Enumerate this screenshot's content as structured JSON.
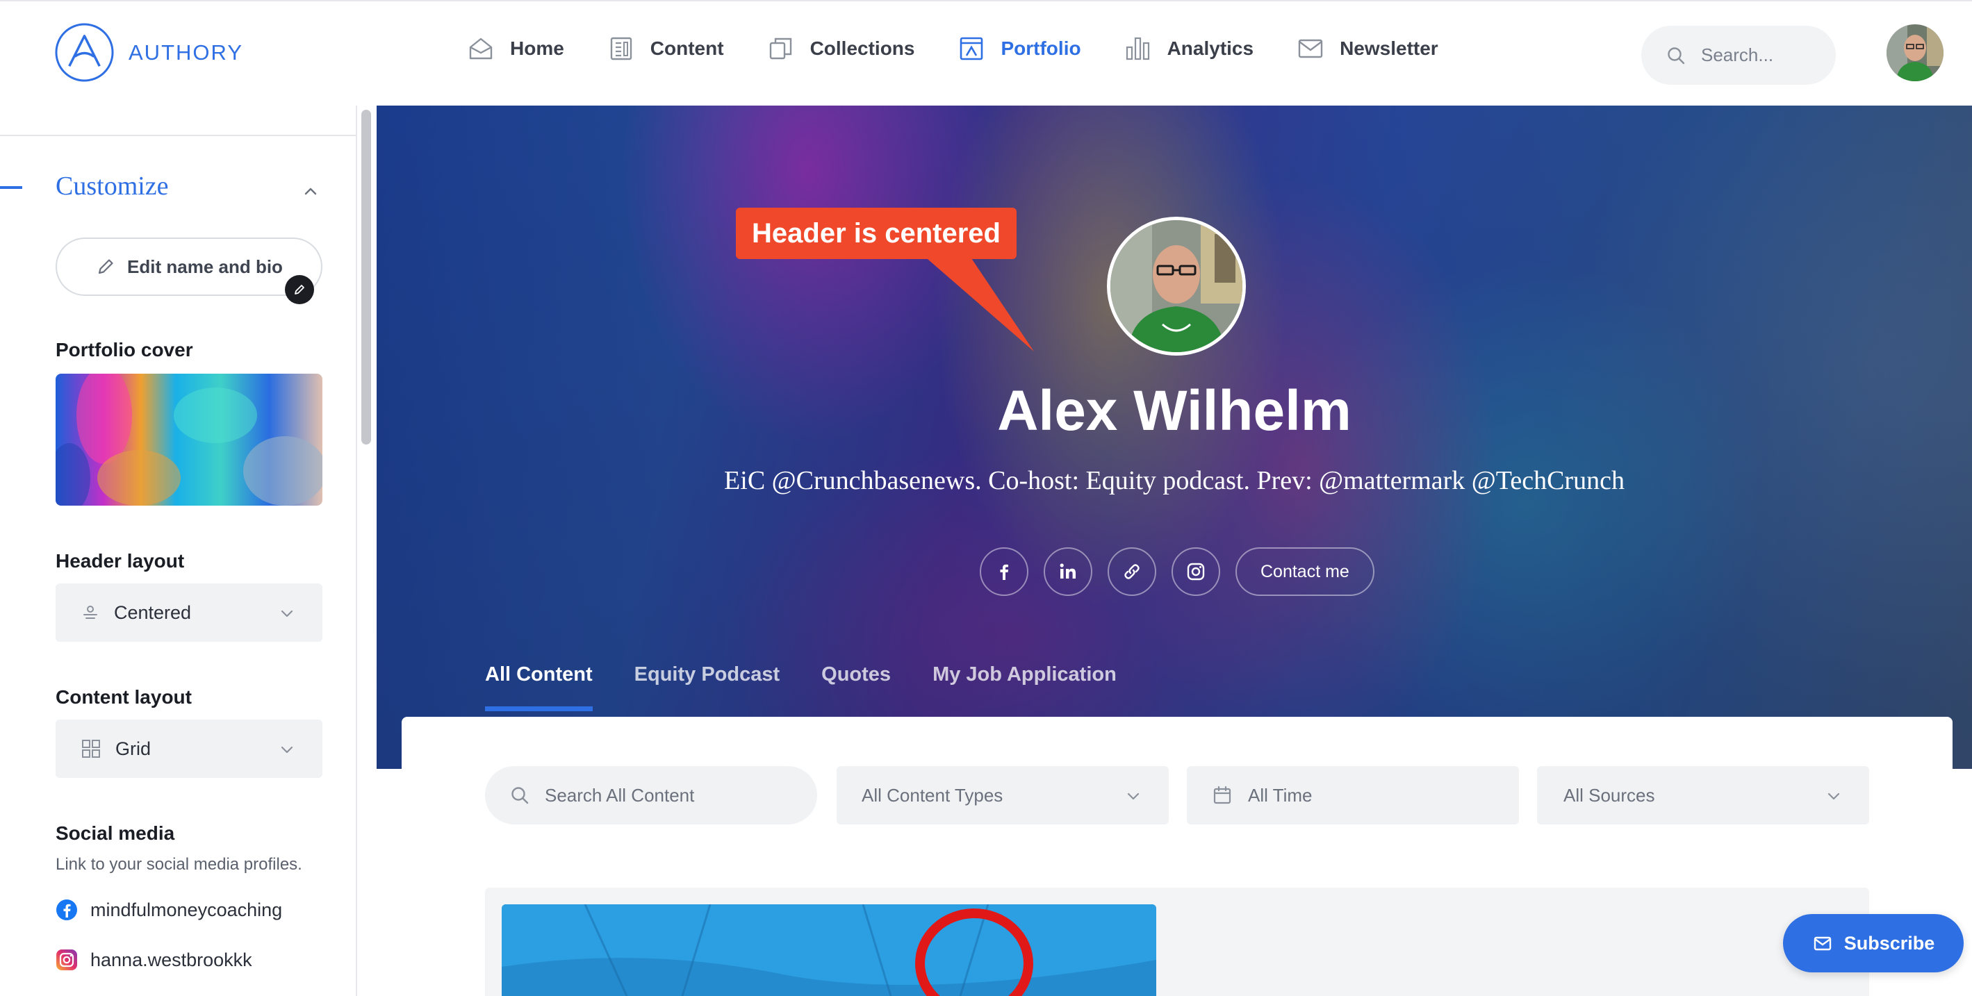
{
  "brand": {
    "name": "AUTHORY",
    "color": "#2f6fe4"
  },
  "nav": {
    "items": [
      {
        "label": "Home",
        "icon": "home-icon"
      },
      {
        "label": "Content",
        "icon": "content-icon"
      },
      {
        "label": "Collections",
        "icon": "collections-icon"
      },
      {
        "label": "Portfolio",
        "icon": "portfolio-icon",
        "active": true
      },
      {
        "label": "Analytics",
        "icon": "analytics-icon"
      },
      {
        "label": "Newsletter",
        "icon": "newsletter-icon"
      }
    ],
    "search_placeholder": "Search..."
  },
  "sidebar": {
    "section_title": "Customize",
    "edit_button": "Edit name and bio",
    "cover_label": "Portfolio cover",
    "header_layout_label": "Header layout",
    "header_layout_value": "Centered",
    "content_layout_label": "Content layout",
    "content_layout_value": "Grid",
    "social_label": "Social media",
    "social_sub": "Link to your social media profiles.",
    "social_profiles": [
      {
        "network": "facebook",
        "handle": "mindfulmoneycoaching",
        "color": "#1877f2"
      },
      {
        "network": "instagram",
        "handle": "hanna.westbrookkk",
        "color": "#e1306c"
      }
    ]
  },
  "profile": {
    "name": "Alex Wilhelm",
    "bio": "EiC @Crunchbasenews. Co-host: Equity podcast. Prev: @mattermark @TechCrunch",
    "socials": [
      "facebook-icon",
      "linkedin-icon",
      "link-icon",
      "instagram-icon"
    ],
    "contact_button": "Contact me"
  },
  "tabs": [
    {
      "label": "All Content",
      "active": true
    },
    {
      "label": "Equity Podcast"
    },
    {
      "label": "Quotes"
    },
    {
      "label": "My Job Application"
    }
  ],
  "filters": {
    "search_placeholder": "Search All Content",
    "content_types": "All Content Types",
    "time": "All Time",
    "sources": "All Sources"
  },
  "subscribe_button": "Subscribe",
  "annotation": {
    "text": "Header is centered",
    "color": "#f0482a"
  }
}
